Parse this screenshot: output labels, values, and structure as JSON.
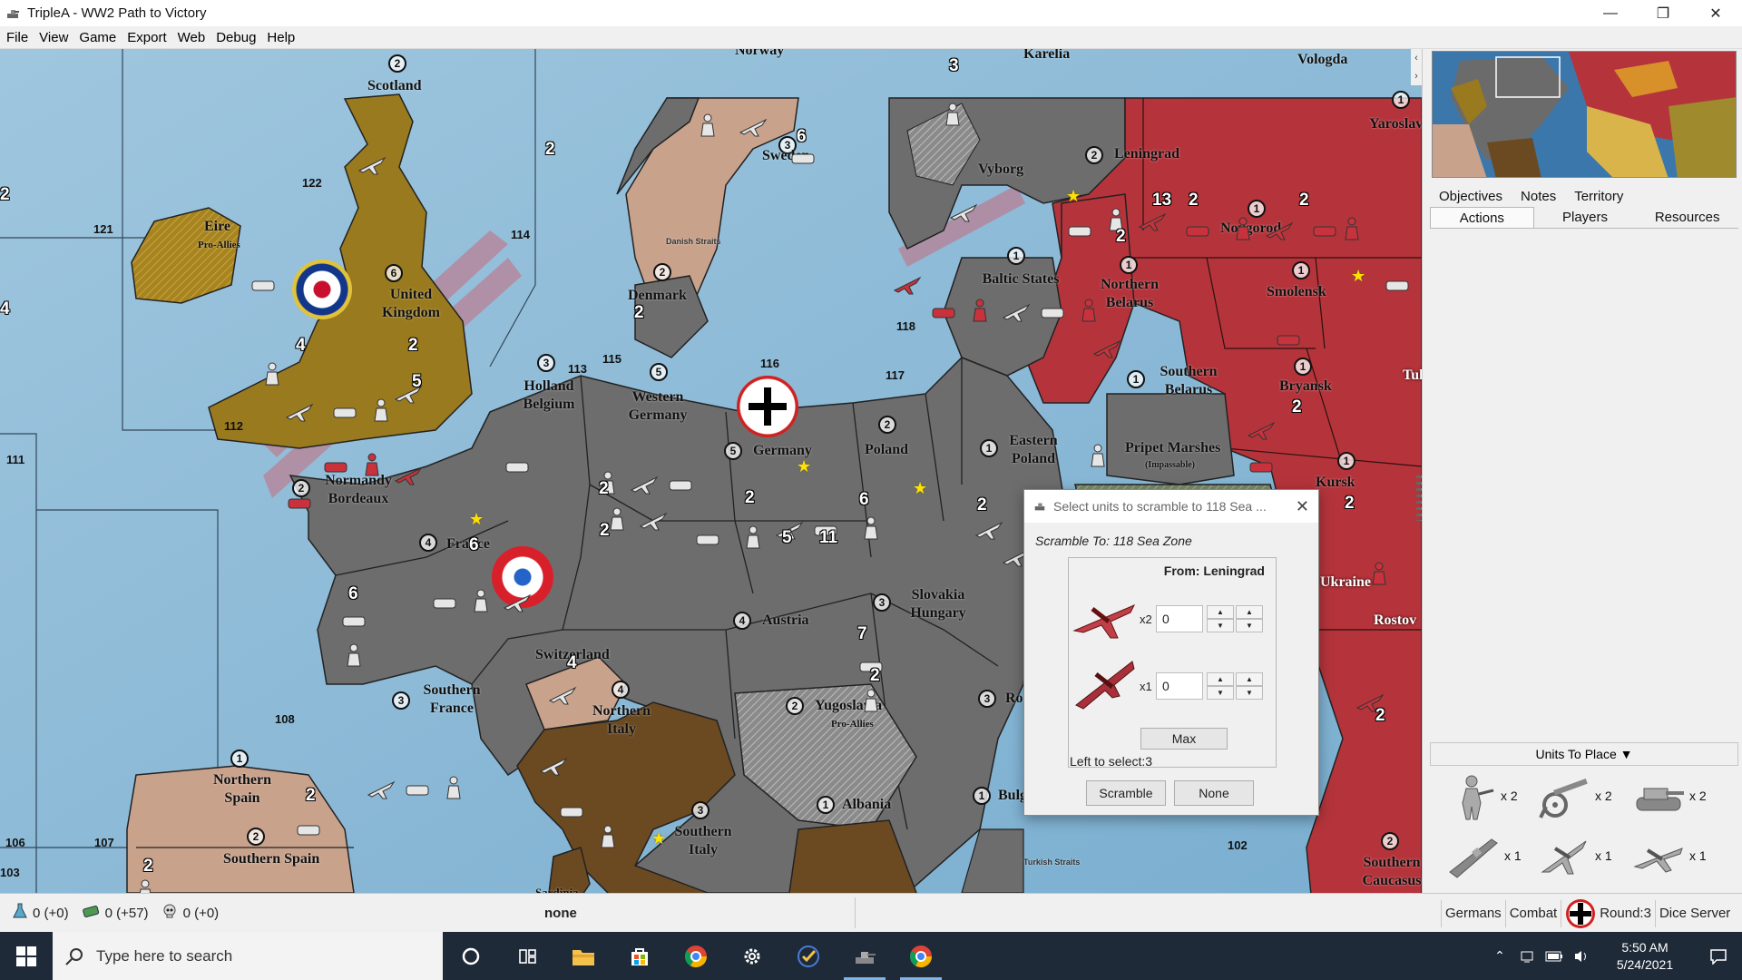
{
  "window": {
    "title": "TripleA - WW2 Path to Victory"
  },
  "menu": [
    "File",
    "View",
    "Game",
    "Export",
    "Web",
    "Debug",
    "Help"
  ],
  "map": {
    "territories": [
      {
        "name": "Scotland",
        "prod": "2"
      },
      {
        "name": "Eire",
        "sub": "Pro-Allies"
      },
      {
        "name": "United Kingdom",
        "prod": "6"
      },
      {
        "name": "Norway"
      },
      {
        "name": "Sweden",
        "prod": "3"
      },
      {
        "name": "Karelia"
      },
      {
        "name": "Vologda"
      },
      {
        "name": "Yaroslavl",
        "prod": "1"
      },
      {
        "name": "Vyborg"
      },
      {
        "name": "Leningrad",
        "prod": "2"
      },
      {
        "name": "Novgorod",
        "prod": "1"
      },
      {
        "name": "Denmark",
        "prod": "2"
      },
      {
        "name": "Baltic States",
        "prod": "1"
      },
      {
        "name": "Northern Belarus",
        "prod": "1"
      },
      {
        "name": "Smolensk",
        "prod": "1"
      },
      {
        "name": "Holland Belgium",
        "prod": "3"
      },
      {
        "name": "Western Germany",
        "prod": "5"
      },
      {
        "name": "Germany",
        "prod": "5"
      },
      {
        "name": "Poland",
        "prod": "2"
      },
      {
        "name": "Southern Belarus",
        "prod": "1"
      },
      {
        "name": "Bryansk",
        "prod": "1"
      },
      {
        "name": "Eastern Poland",
        "prod": "1"
      },
      {
        "name": "Pripet Marshes",
        "sub": "(Impassable)"
      },
      {
        "name": "Kursk",
        "prod": "1"
      },
      {
        "name": "Normandy Bordeaux",
        "prod": "2"
      },
      {
        "name": "France",
        "prod": "4"
      },
      {
        "name": "Switzerland"
      },
      {
        "name": "Austria",
        "prod": "4"
      },
      {
        "name": "Slovakia Hungary",
        "prod": "3"
      },
      {
        "name": "Southern France",
        "prod": "3"
      },
      {
        "name": "Northern Italy",
        "prod": "4"
      },
      {
        "name": "Yugoslavia",
        "prod": "2",
        "sub": "Pro-Allies"
      },
      {
        "name": "Romania",
        "prod": "3"
      },
      {
        "name": "Northern Spain",
        "prod": "1"
      },
      {
        "name": "Southern Spain",
        "prod": "2"
      },
      {
        "name": "Southern Italy",
        "prod": "3"
      },
      {
        "name": "Albania",
        "prod": "1"
      },
      {
        "name": "Bulgaria",
        "prod": "1"
      },
      {
        "name": "Southern Caucasus",
        "prod": "2"
      },
      {
        "name": "Ukraine"
      },
      {
        "name": "Rostov"
      },
      {
        "name": "Tula"
      }
    ],
    "sea_zones": [
      "121",
      "122",
      "114",
      "113",
      "115",
      "116",
      "117",
      "118",
      "112",
      "111",
      "108",
      "107",
      "106",
      "102",
      "103"
    ],
    "labels": {
      "danish_straits": "Danish Straits",
      "turkish_straits": "Turkish Straits",
      "sardinia": "Sardinia"
    },
    "unit_counts": [
      "2",
      "3",
      "2",
      "2",
      "6",
      "2",
      "2",
      "13",
      "2",
      "2",
      "2",
      "4",
      "2",
      "4",
      "2",
      "5",
      "2",
      "2",
      "2",
      "2",
      "6",
      "5",
      "11",
      "2",
      "2",
      "2",
      "6",
      "4",
      "6",
      "7",
      "2",
      "2",
      "2",
      "2"
    ]
  },
  "right_panel": {
    "tabs_row1": [
      "Objectives",
      "Notes",
      "Territory"
    ],
    "tabs_row2": [
      "Actions",
      "Players",
      "Resources"
    ],
    "active_tab": "Actions",
    "units_to_place": {
      "header": "Units To Place ▼",
      "items": [
        {
          "unit": "infantry-icon",
          "mult": "x 2"
        },
        {
          "unit": "artillery-icon",
          "mult": "x 2"
        },
        {
          "unit": "tank-icon",
          "mult": "x 2"
        },
        {
          "unit": "destroyer-icon",
          "mult": "x 1"
        },
        {
          "unit": "fighter-icon",
          "mult": "x 1"
        },
        {
          "unit": "tactical-bomber-icon",
          "mult": "x 1"
        }
      ]
    }
  },
  "status_bar": {
    "resources": [
      {
        "icon": "flask-icon",
        "value": "0 (+0)"
      },
      {
        "icon": "money-icon",
        "value": "0 (+57)"
      },
      {
        "icon": "skull-icon",
        "value": "0 (+0)"
      }
    ],
    "step": "none",
    "player": "Germans",
    "phase": "Combat",
    "round": "Round:3",
    "dice_server": "Dice Server On"
  },
  "dialog": {
    "title": "Select units to scramble to 118 Sea ...",
    "scramble_to": "Scramble To: 118 Sea Zone",
    "from": "From: Leningrad",
    "rows": [
      {
        "unit": "fighter-icon",
        "mult": "x2",
        "value": "0"
      },
      {
        "unit": "tactical-bomber-icon",
        "mult": "x1",
        "value": "0"
      }
    ],
    "max_label": "Max",
    "left_to_select": "Left to select:3",
    "scramble_label": "Scramble",
    "none_label": "None"
  },
  "taskbar": {
    "search_placeholder": "Type here to search",
    "time": "5:50 AM",
    "date": "5/24/2021"
  },
  "colors": {
    "sea": "#8fb9d6",
    "germany": "#6d6d6d",
    "ussr": "#b5343b",
    "uk": "#9a7a1e",
    "italy": "#6b4a22",
    "neutral": "#c9a28c",
    "taskbar": "#1f2a38"
  }
}
